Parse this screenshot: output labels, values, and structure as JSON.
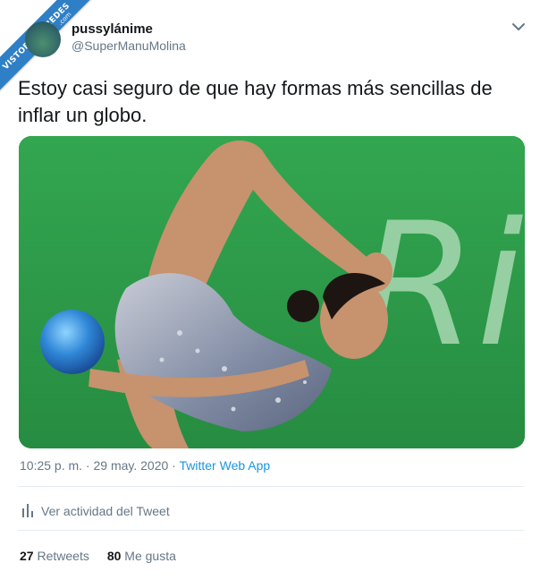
{
  "watermark": {
    "text": "VISTOENLASREDES",
    "suffix": ".com"
  },
  "tweet": {
    "display_name": "pussylánime",
    "handle": "@SuperManuMolina",
    "text": "Estoy casi seguro de que hay formas más sencillas de inflar un globo.",
    "timestamp": "10:25 p. m. · 29 may. 2020",
    "separator": " · ",
    "source": "Twitter Web App",
    "activity_label": "Ver actividad del Tweet",
    "retweets_count": "27",
    "retweets_label": "Retweets",
    "likes_count": "80",
    "likes_label": "Me gusta"
  },
  "media": {
    "description_icon": "photo",
    "background_text": "Ri"
  },
  "colors": {
    "link": "#1b95e0",
    "secondary_text": "#657786",
    "primary_text": "#14171a",
    "watermark_blue": "#2f7fc6",
    "photo_green": "#2e9c49"
  },
  "icons": [
    "chevron-down-icon",
    "activity-icon"
  ]
}
